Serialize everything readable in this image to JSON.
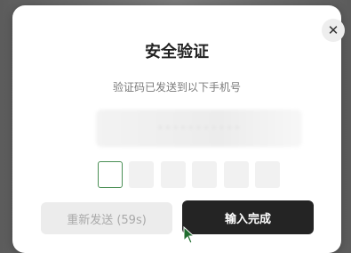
{
  "dialog": {
    "title": "安全验证",
    "subtitle": "验证码已发送到以下手机号",
    "phone_masked": "•••••••••••",
    "close_glyph": "✕",
    "code_cells": [
      "",
      "",
      "",
      "",
      "",
      ""
    ],
    "active_cell_index": 0
  },
  "buttons": {
    "resend_label": "重新发送 (59s)",
    "done_label": "输入完成"
  },
  "icons": {
    "close": "close-icon",
    "cursor": "mouse-pointer-icon"
  },
  "colors": {
    "primary_button": "#242424",
    "active_cell_border": "#4a8f55",
    "disabled_button": "#ececec"
  }
}
